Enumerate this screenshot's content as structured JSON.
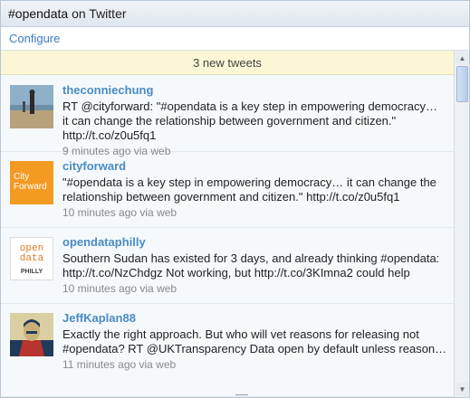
{
  "header": {
    "hashtag": "#opendata",
    "suffix": " on Twitter"
  },
  "toolbar": {
    "configure_label": "Configure"
  },
  "notice": {
    "new_tweets_label": "3 new tweets"
  },
  "tweets": [
    {
      "username": "theconniechung",
      "lines": [
        "RT @cityforward: \"#opendata is a key step in empowering democracy…",
        "it can change the relationship between government and citizen.\"",
        "http://t.co/z0u5fq1"
      ],
      "meta": "9 minutes ago via web",
      "avatar": "beach-photo-avatar"
    },
    {
      "username": "cityforward",
      "lines": [
        "\"#opendata is a key step in empowering democracy… it can change the",
        "relationship between government and citizen.\" http://t.co/z0u5fq1"
      ],
      "meta": "10 minutes ago via web",
      "avatar": "cityforward-logo-avatar",
      "logo_text": [
        "City",
        "Forward"
      ]
    },
    {
      "username": "opendataphilly",
      "lines": [
        "Southern Sudan has existed for 3 days, and already thinking #opendata:",
        "http://t.co/NzChdgz Not working, but http://t.co/3KImna2 could help"
      ],
      "meta": "10 minutes ago via web",
      "avatar": "opendataphilly-logo-avatar",
      "logo_text": [
        "open",
        "data",
        "PHILLY"
      ]
    },
    {
      "username": "JeffKaplan88",
      "lines": [
        "Exactly the right approach. But who will vet reasons for releasing not",
        "#opendata? RT @UKTransparency Data open by default unless reason…"
      ],
      "meta": "11 minutes ago via web",
      "avatar": "poster-portrait-avatar"
    }
  ],
  "colors": {
    "link": "#3b7bbf",
    "username": "#4a8bc2",
    "notice_bg": "#fbf6d5",
    "accent_orange": "#f39a23"
  }
}
